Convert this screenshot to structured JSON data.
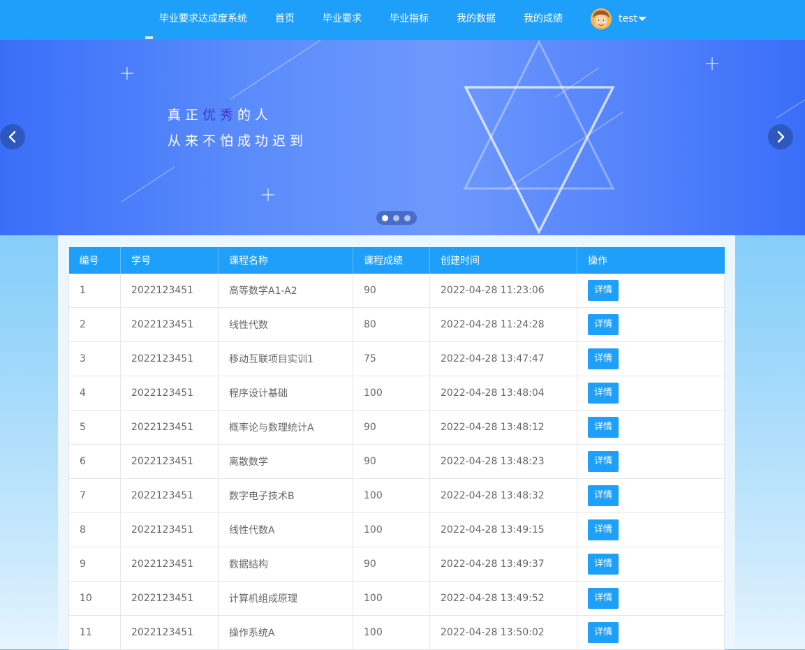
{
  "nav": {
    "brand": "毕业要求达成度系统",
    "items": [
      "首页",
      "毕业要求",
      "毕业指标",
      "我的数据",
      "我的成绩"
    ],
    "user": {
      "name": "test",
      "avatar_icon": "cartoon-avatar"
    }
  },
  "banner": {
    "slogan_line1": [
      "真正",
      "优秀",
      "的人"
    ],
    "slogan_line2": "从来不怕成功迟到",
    "accent_color": "#4338ca",
    "active_slide": 1,
    "slide_count": 3
  },
  "table": {
    "headers": [
      "编号",
      "学号",
      "课程名称",
      "课程成绩",
      "创建时间",
      "操作"
    ],
    "action_label": "详情",
    "rows": [
      [
        "1",
        "2022123451",
        "高等数学A1-A2",
        "90",
        "2022-04-28 11:23:06"
      ],
      [
        "2",
        "2022123451",
        "线性代数",
        "80",
        "2022-04-28 11:24:28"
      ],
      [
        "3",
        "2022123451",
        "移动互联项目实训1",
        "75",
        "2022-04-28 13:47:47"
      ],
      [
        "4",
        "2022123451",
        "程序设计基础",
        "100",
        "2022-04-28 13:48:04"
      ],
      [
        "5",
        "2022123451",
        "概率论与数理统计A",
        "90",
        "2022-04-28 13:48:12"
      ],
      [
        "6",
        "2022123451",
        "离散数学",
        "90",
        "2022-04-28 13:48:23"
      ],
      [
        "7",
        "2022123451",
        "数字电子技术B",
        "100",
        "2022-04-28 13:48:32"
      ],
      [
        "8",
        "2022123451",
        "线性代数A",
        "100",
        "2022-04-28 13:49:15"
      ],
      [
        "9",
        "2022123451",
        "数据结构",
        "90",
        "2022-04-28 13:49:37"
      ],
      [
        "10",
        "2022123451",
        "计算机组成原理",
        "100",
        "2022-04-28 13:49:52"
      ],
      [
        "11",
        "2022123451",
        "操作系统A",
        "100",
        "2022-04-28 13:50:02"
      ]
    ]
  },
  "colors": {
    "primary": "#1e9ff9",
    "banner": "#5a8bfb"
  }
}
